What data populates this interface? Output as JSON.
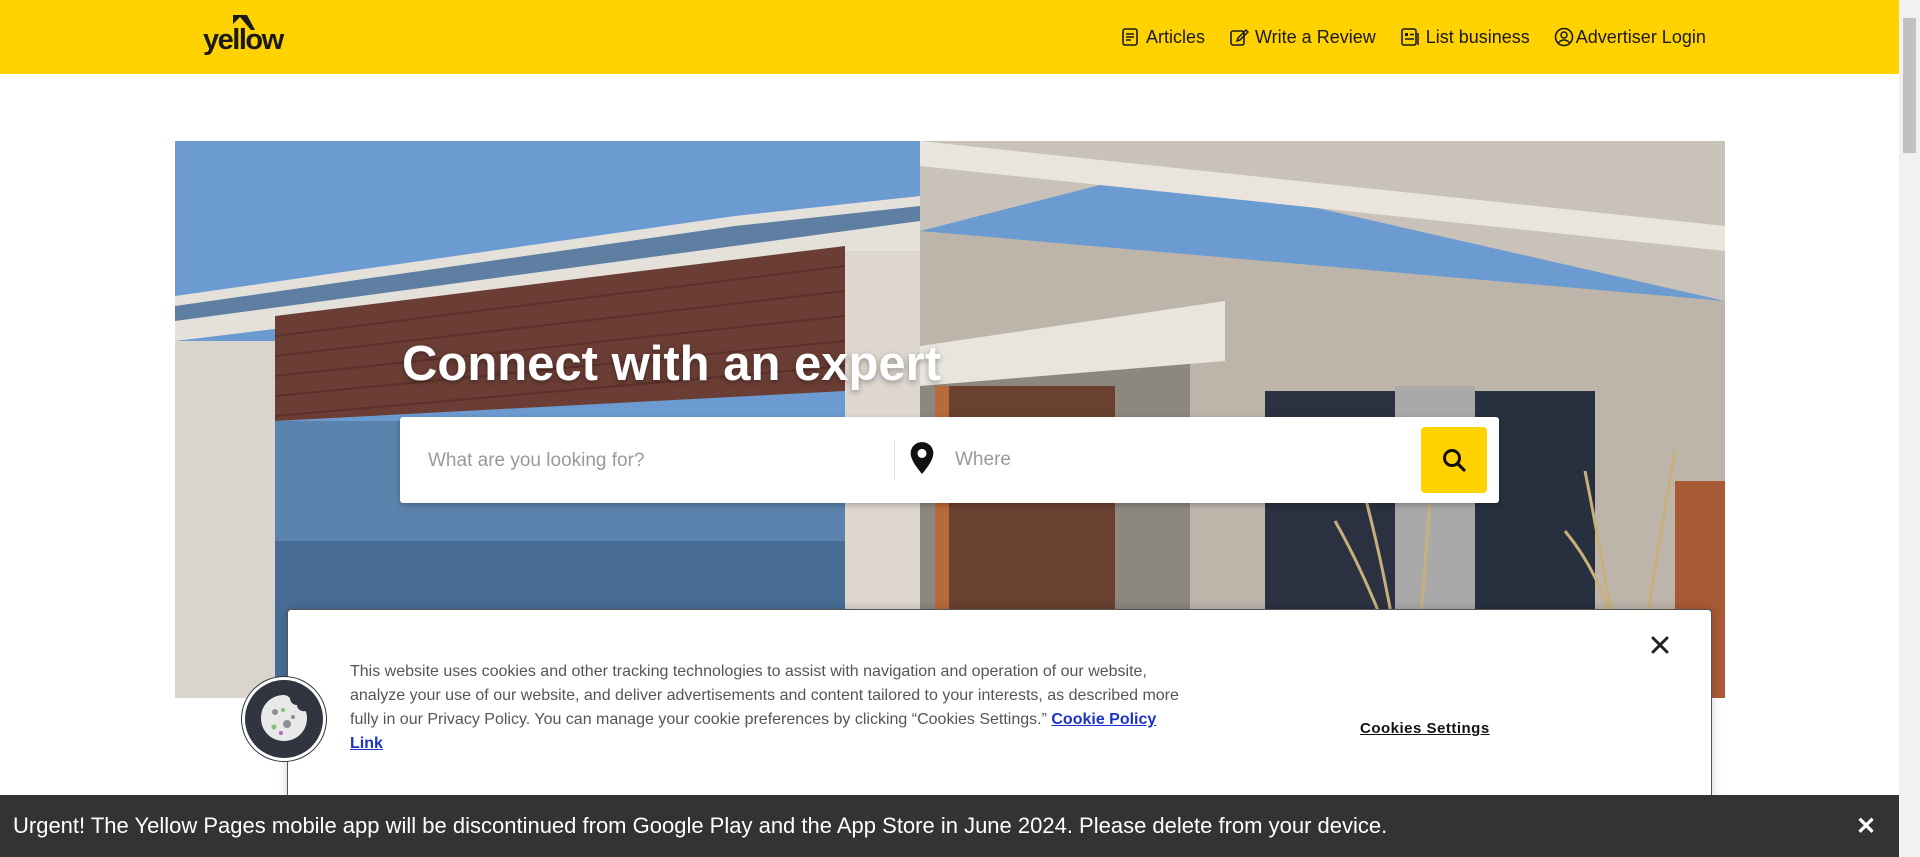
{
  "header": {
    "logo_text": "yellow",
    "nav": {
      "articles": "Articles",
      "write_review": "Write a Review",
      "list_business": "List business",
      "advertiser_login": "Advertiser Login"
    }
  },
  "hero": {
    "title": "Connect with an expert",
    "search": {
      "what_placeholder": "What are you looking for?",
      "where_placeholder": "Where"
    }
  },
  "cookie_banner": {
    "text": "This website uses cookies and other tracking technologies to assist with navigation and operation of our website, analyze your use of our website, and deliver advertisements and content tailored to your interests, as described more fully in our Privacy Policy.  You can manage your cookie preferences by clicking “Cookies Settings.” ",
    "policy_link": "Cookie Policy Link",
    "settings_button": "Cookies Settings"
  },
  "urgent_bar": {
    "message": "Urgent! The Yellow Pages mobile app will be discontinued from Google Play and the App Store in June 2024. Please delete from your device.",
    "close_glyph": "✕"
  },
  "colors": {
    "brand_yellow": "#ffd200",
    "urgent_bg": "#333333",
    "link_blue": "#1a33c9"
  },
  "icons": [
    "article-icon",
    "edit-icon",
    "list-icon",
    "user-circle-icon",
    "location-pin-icon",
    "search-icon",
    "close-icon",
    "cookie-icon"
  ]
}
